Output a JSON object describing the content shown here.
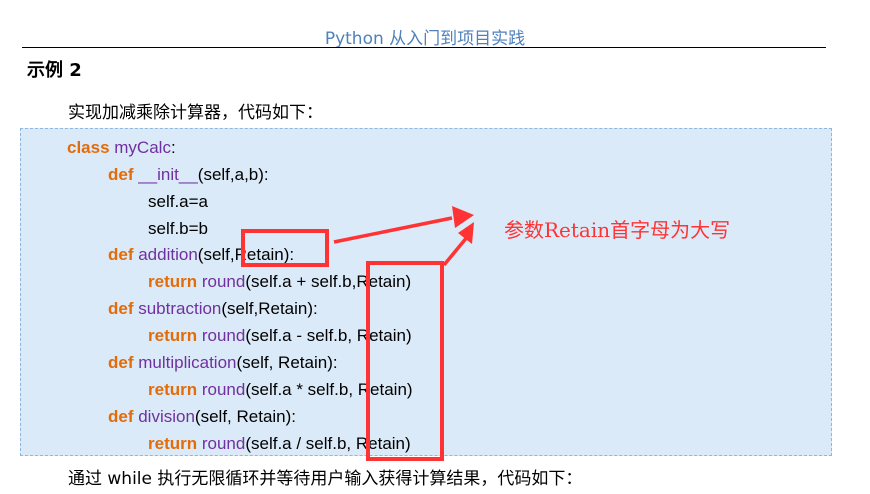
{
  "header": {
    "title": "Python 从入门到项目实践"
  },
  "section": {
    "heading": "示例 2"
  },
  "paragraphs": {
    "intro": "实现加减乘除计算器，代码如下：",
    "outro": "通过 while 执行无限循环并等待用户输入获得计算结果，代码如下："
  },
  "code": {
    "l1": {
      "kw": "class",
      "name": " myCalc",
      "rest": ":"
    },
    "l2": {
      "kw": "def",
      "name": " __init__",
      "rest": "(self,a,b):"
    },
    "l3": {
      "text": "self.a=a"
    },
    "l4": {
      "text": "self.b=b"
    },
    "l5": {
      "kw": "def",
      "name": " addition",
      "rest": "(self,Retain):"
    },
    "l6": {
      "kw": "return",
      "fn": " round",
      "rest": "(self.a + self.b,Retain)"
    },
    "l7": {
      "kw": "def",
      "name": " subtraction",
      "rest": "(self,Retain):"
    },
    "l8": {
      "kw": "return",
      "fn": " round",
      "rest": "(self.a - self.b, Retain)"
    },
    "l9": {
      "kw": "def",
      "name": " multiplication",
      "rest": "(self, Retain):"
    },
    "l10": {
      "kw": "return",
      "fn": " round",
      "rest": "(self.a * self.b, Retain)"
    },
    "l11": {
      "kw": "def",
      "name": " division",
      "rest": "(self, Retain):"
    },
    "l12": {
      "kw": "return",
      "fn": " round",
      "rest": "(self.a / self.b, Retain)"
    }
  },
  "annotation": {
    "text": "参数Retain首字母为大写",
    "color": "#ff3333"
  },
  "colors": {
    "keyword": "#e36c09",
    "name": "#7030a0",
    "code_bg": "#dbeaf8",
    "header": "#4f81bd"
  }
}
